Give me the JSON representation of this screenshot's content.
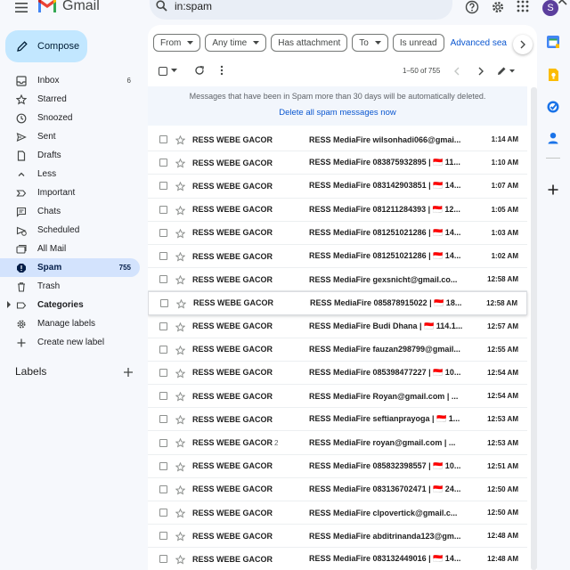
{
  "app": {
    "name": "Gmail"
  },
  "header": {
    "search_value": "in:spam",
    "avatar_initial": "S"
  },
  "sidebar": {
    "compose_label": "Compose",
    "items": [
      {
        "label": "Inbox",
        "count": "6",
        "icon": "inbox-icon",
        "bold": true
      },
      {
        "label": "Starred",
        "count": "",
        "icon": "star-icon"
      },
      {
        "label": "Snoozed",
        "count": "",
        "icon": "clock-icon"
      },
      {
        "label": "Sent",
        "count": "",
        "icon": "send-icon"
      },
      {
        "label": "Drafts",
        "count": "",
        "icon": "draft-icon"
      },
      {
        "label": "Less",
        "count": "",
        "icon": "chevron-up-icon"
      },
      {
        "label": "Important",
        "count": "",
        "icon": "important-icon"
      },
      {
        "label": "Chats",
        "count": "",
        "icon": "chat-icon"
      },
      {
        "label": "Scheduled",
        "count": "",
        "icon": "scheduled-icon"
      },
      {
        "label": "All Mail",
        "count": "",
        "icon": "all-mail-icon"
      },
      {
        "label": "Spam",
        "count": "755",
        "icon": "spam-icon",
        "active": true
      },
      {
        "label": "Trash",
        "count": "",
        "icon": "trash-icon"
      },
      {
        "label": "Categories",
        "count": "",
        "icon": "label-icon",
        "bold": true,
        "caret": true
      },
      {
        "label": "Manage labels",
        "count": "",
        "icon": "gear-icon"
      },
      {
        "label": "Create new label",
        "count": "",
        "icon": "plus-icon"
      }
    ],
    "labels_heading": "Labels"
  },
  "filters": [
    "From",
    "Any time",
    "Has attachment",
    "To",
    "Is unread"
  ],
  "filters_dropdown": [
    true,
    true,
    false,
    true,
    false
  ],
  "advanced_search": "Advanced sea",
  "toolbar": {
    "pagination": "1–50 of 755"
  },
  "notice": {
    "text": "Messages that have been in Spam more than 30 days will be automatically deleted.",
    "link": "Delete all spam messages now"
  },
  "colors": {
    "accent": "#0b57d0",
    "compose": "#c2e7ff",
    "active_nav": "#d3e3fd"
  },
  "emails": [
    {
      "sender": "RESS WEBE GACOR",
      "count": "",
      "subject": "RESS MediaFire wilsonhadi066@gmai...",
      "time": "1:14 AM"
    },
    {
      "sender": "RESS WEBE GACOR",
      "count": "",
      "subject": "RESS MediaFire 083875932895 | 🇮🇩 11...",
      "time": "1:10 AM"
    },
    {
      "sender": "RESS WEBE GACOR",
      "count": "",
      "subject": "RESS MediaFire 083142903851 | 🇮🇩 14...",
      "time": "1:07 AM"
    },
    {
      "sender": "RESS WEBE GACOR",
      "count": "",
      "subject": "RESS MediaFire 081211284393 | 🇮🇩 12...",
      "time": "1:05 AM"
    },
    {
      "sender": "RESS WEBE GACOR",
      "count": "",
      "subject": "RESS MediaFire 081251021286 | 🇮🇩 14...",
      "time": "1:03 AM"
    },
    {
      "sender": "RESS WEBE GACOR",
      "count": "",
      "subject": "RESS MediaFire 081251021286 | 🇮🇩 14...",
      "time": "1:02 AM"
    },
    {
      "sender": "RESS WEBE GACOR",
      "count": "",
      "subject": "RESS MediaFire gexsnicht@gmail.co...",
      "time": "12:58 AM"
    },
    {
      "sender": "RESS WEBE GACOR",
      "count": "",
      "subject": "RESS MediaFire 085878915022 | 🇮🇩 18...",
      "time": "12:58 AM"
    },
    {
      "sender": "RESS WEBE GACOR",
      "count": "",
      "subject": "RESS MediaFire Budi Dhana | 🇮🇩 114.1...",
      "time": "12:57 AM"
    },
    {
      "sender": "RESS WEBE GACOR",
      "count": "",
      "subject": "RESS MediaFire fauzan298799@gmail...",
      "time": "12:55 AM"
    },
    {
      "sender": "RESS WEBE GACOR",
      "count": "",
      "subject": "RESS MediaFire 085398477227 | 🇮🇩 10...",
      "time": "12:54 AM"
    },
    {
      "sender": "RESS WEBE GACOR",
      "count": "",
      "subject": "RESS MediaFire Royan@gmail.com | ...",
      "time": "12:54 AM"
    },
    {
      "sender": "RESS WEBE GACOR",
      "count": "",
      "subject": "RESS MediaFire seftianprayoga | 🇮🇩 1...",
      "time": "12:53 AM"
    },
    {
      "sender": "RESS WEBE GACOR",
      "count": "2",
      "subject": "RESS MediaFire royan@gmail.com | ...",
      "time": "12:53 AM"
    },
    {
      "sender": "RESS WEBE GACOR",
      "count": "",
      "subject": "RESS MediaFire 085832398557 | 🇮🇩 10...",
      "time": "12:51 AM"
    },
    {
      "sender": "RESS WEBE GACOR",
      "count": "",
      "subject": "RESS MediaFire 083136702471 | 🇮🇩 24...",
      "time": "12:50 AM"
    },
    {
      "sender": "RESS WEBE GACOR",
      "count": "",
      "subject": "RESS MediaFire clpovertick@gmail.c...",
      "time": "12:50 AM"
    },
    {
      "sender": "RESS WEBE GACOR",
      "count": "",
      "subject": "RESS MediaFire abditrinanda123@gm...",
      "time": "12:48 AM"
    },
    {
      "sender": "RESS WEBE GACOR",
      "count": "",
      "subject": "RESS MediaFire 083132449016 | 🇮🇩 14...",
      "time": "12:48 AM"
    }
  ]
}
